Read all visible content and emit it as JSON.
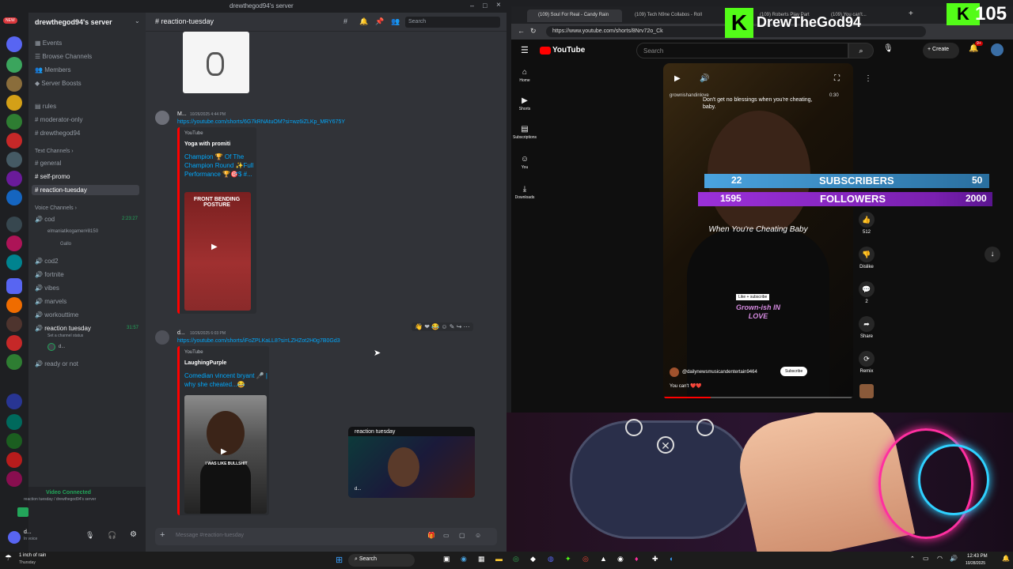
{
  "discord": {
    "window_title": "drewthegod94's server",
    "server_name": "drewthegod94's server",
    "channel_name": "reaction-tuesday",
    "search_placeholder": "Search",
    "menu": [
      "Events",
      "Browse Channels",
      "Members",
      "Server Boosts"
    ],
    "top_channels": [
      "rules",
      "moderator-only",
      "drewthegod94"
    ],
    "text_category": "Text Channels",
    "text_channels": [
      "general",
      "self-promo",
      "reaction-tuesday"
    ],
    "voice_category": "Voice Channels",
    "voice": {
      "cod": "cod",
      "cod_time": "2:23:27",
      "cod_users": [
        "elmaniatikogamer#8150",
        "Gallo"
      ]
    },
    "voice_channels": [
      "cod2",
      "fortnite",
      "vibes",
      "marvels",
      "workouttime"
    ],
    "reaction_voice": {
      "name": "reaction tuesday",
      "time": "31:57",
      "status": "Set a channel status",
      "user": "d..."
    },
    "ready": "ready or not",
    "vc_status": "Video Connected",
    "vc_sub": "reaction tuesday / drewthegod94's server",
    "user_name": "d...",
    "user_sub": "In voice",
    "new_badge": "NEW",
    "messages": [
      {
        "author": "M...",
        "time": "10/26/2025 4:44 PM",
        "link": "https://youtube.com/shorts/6G7kRNAtuOM?si=wz6iZLKp_MRY675Y",
        "provider": "YouTube",
        "embed_author": "Yoga with promiti",
        "embed_title": "Champion 🏆 Of The Champion Round ✨Full Performance 🏆🎯$ #...",
        "thumb_text": "FRONT BENDING POSTURE"
      },
      {
        "author": "d...",
        "time": "10/26/2025 6:03 PM",
        "link": "https://youtube.com/shorts/iFoZPLKaLL8?si=LZHZot2H0g7B0Gd3",
        "provider": "YouTube",
        "embed_author": "LaughingPurple",
        "embed_title": "Comedian vincent bryant 🎤 | why she cheated...😂",
        "thumb_text": "I WAS LIKE BULLSHIT"
      }
    ],
    "popout_title": "reaction tuesday",
    "popout_user": "d...",
    "composer_placeholder": "Message #reaction-tuesday"
  },
  "browser": {
    "tabs": [
      "(109) Soul For Real - Candy Rain",
      "(109) Tech N9ne Collabos - Roll",
      "(109) Roberts Play Part",
      "(109) You can't..."
    ],
    "url": "https://www.youtube.com/shorts/8Nrv72o_Ck",
    "yt_logo": "YouTube",
    "yt_search": "Search",
    "create": "Create",
    "notif": "9+",
    "nav": [
      "Home",
      "Shorts",
      "Subscriptions",
      "You",
      "Downloads"
    ],
    "video": {
      "channel": "grownishandinlove",
      "time": "0:30",
      "caption": "Don't get no blessings when you're cheating, baby.",
      "title": "When You're Cheating Baby",
      "sticker_top": "Like + subscribe",
      "sticker": "Grown-ish IN LOVE",
      "uploader": "@dailynewsmusicandentertain9464",
      "subscribe": "Subscribe",
      "comment_preview": "You can't ❤️❤️"
    },
    "actions": [
      {
        "label": "512"
      },
      {
        "label": "Dislike"
      },
      {
        "label": "2"
      },
      {
        "label": "Share"
      },
      {
        "label": "Remix"
      }
    ]
  },
  "overlay": {
    "streamer": "DrewTheGod94",
    "viewer_count": "105",
    "subs_current": "22",
    "subs_label": "SUBSCRIBERS",
    "subs_goal": "50",
    "fol_current": "1595",
    "fol_label": "FOLLOWERS",
    "fol_goal": "2000"
  },
  "taskbar": {
    "weather": "1 inch of rain",
    "weather_day": "Thursday",
    "search": "Search",
    "time": "12:43 PM",
    "date": "10/28/2025"
  },
  "colors": {
    "discord_bg": "#313338",
    "youtube_red": "#ff0000",
    "sub_bar": "#4aa3df",
    "fol_bar": "#9b30d9",
    "kick_green": "#53fc18"
  }
}
